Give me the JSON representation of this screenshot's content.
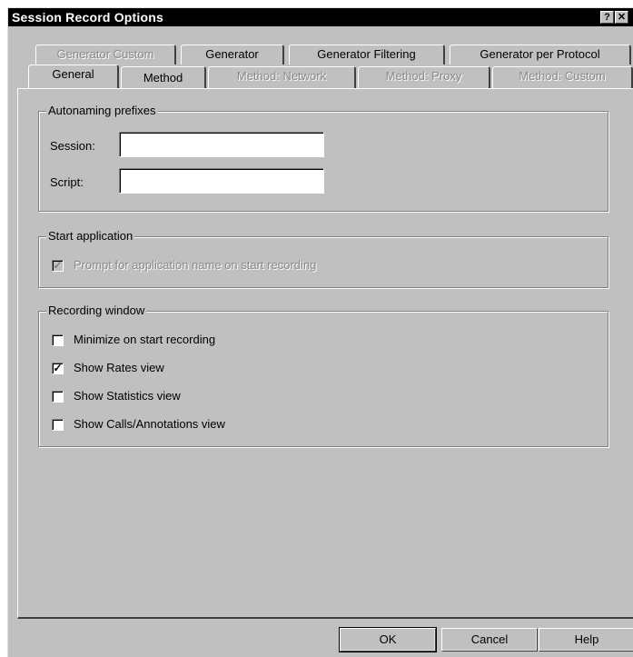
{
  "window": {
    "title": "Session Record Options",
    "help_glyph": "?",
    "close_glyph": "✕"
  },
  "tabs_back": [
    {
      "label": "Generator Custom",
      "enabled": false
    },
    {
      "label": "Generator",
      "enabled": true
    },
    {
      "label": "Generator Filtering",
      "enabled": true
    },
    {
      "label": "Generator per Protocol",
      "enabled": true
    }
  ],
  "tabs_front": [
    {
      "label": "General",
      "enabled": true,
      "selected": true
    },
    {
      "label": "Method",
      "enabled": true
    },
    {
      "label": "Method: Network",
      "enabled": false
    },
    {
      "label": "Method: Proxy",
      "enabled": false
    },
    {
      "label": "Method: Custom",
      "enabled": false
    }
  ],
  "autonaming": {
    "legend": "Autonaming prefixes",
    "session_label": "Session:",
    "session_value": "",
    "script_label": "Script:",
    "script_value": ""
  },
  "start_application": {
    "legend": "Start application",
    "prompt_label": "Prompt for application name on start recording",
    "prompt_checked": true,
    "prompt_enabled": false
  },
  "recording_window": {
    "legend": "Recording window",
    "options": [
      {
        "label": "Minimize on start recording",
        "checked": false
      },
      {
        "label": "Show Rates view",
        "checked": true
      },
      {
        "label": "Show Statistics view",
        "checked": false
      },
      {
        "label": "Show Calls/Annotations view",
        "checked": false
      }
    ]
  },
  "buttons": {
    "ok": "OK",
    "cancel": "Cancel",
    "help": "Help"
  }
}
